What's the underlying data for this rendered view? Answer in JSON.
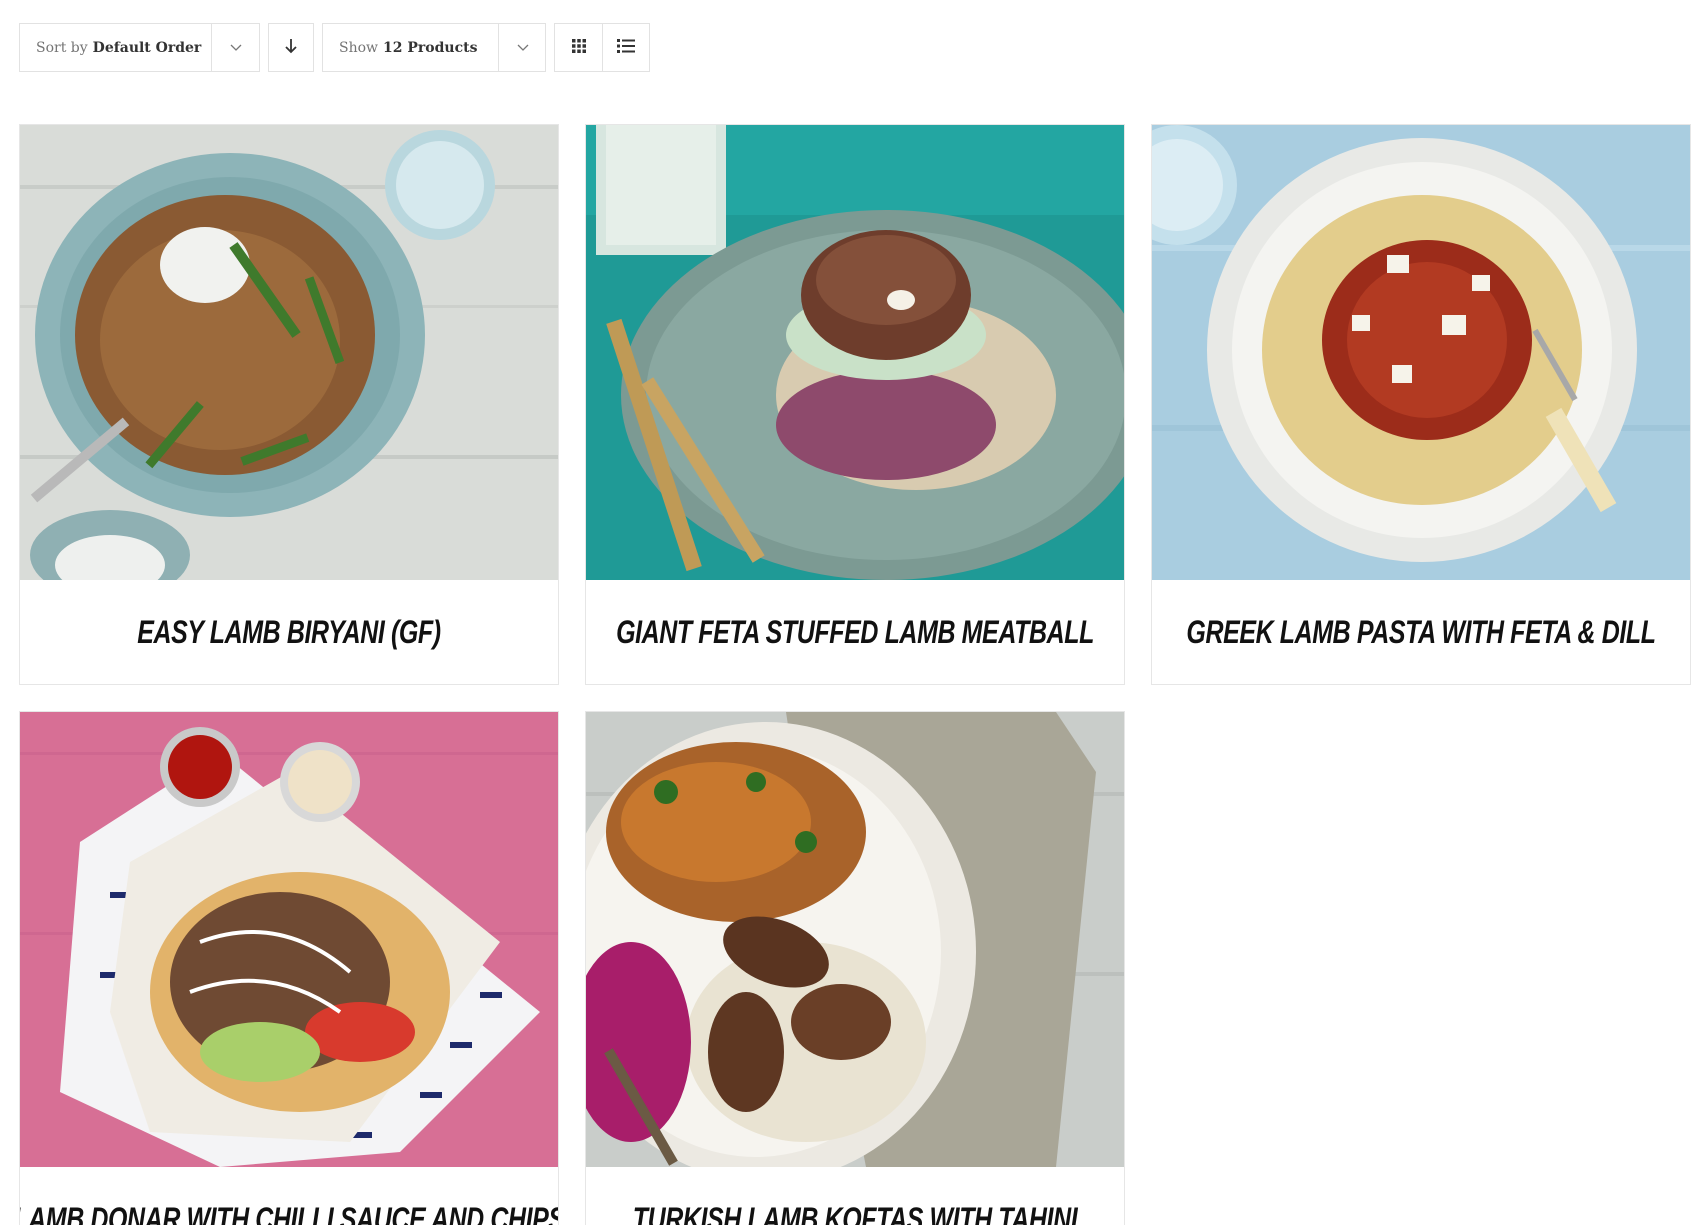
{
  "toolbar": {
    "sort": {
      "prefix": "Sort by",
      "value": "Default Order"
    },
    "show": {
      "prefix": "Show",
      "value": "12 Products"
    },
    "icons": {
      "sort_caret": "chevron-down-icon",
      "sort_direction": "arrow-down-icon",
      "show_caret": "chevron-down-icon",
      "grid_view": "grid-view-icon",
      "list_view": "list-view-icon"
    }
  },
  "products": [
    {
      "title": "Easy Lamb Biryani (GF)"
    },
    {
      "title": "Giant Feta Stuffed Lamb Meatball"
    },
    {
      "title": "Greek Lamb Pasta with Feta & Dill"
    },
    {
      "title": "Lamb Donar with Chilli Sauce and Chips"
    },
    {
      "title": "Turkish Lamb Koftas with Tahini"
    }
  ],
  "colors": {
    "border": "#e2e2e2",
    "title_text": "#111111",
    "muted_text": "#747474"
  }
}
